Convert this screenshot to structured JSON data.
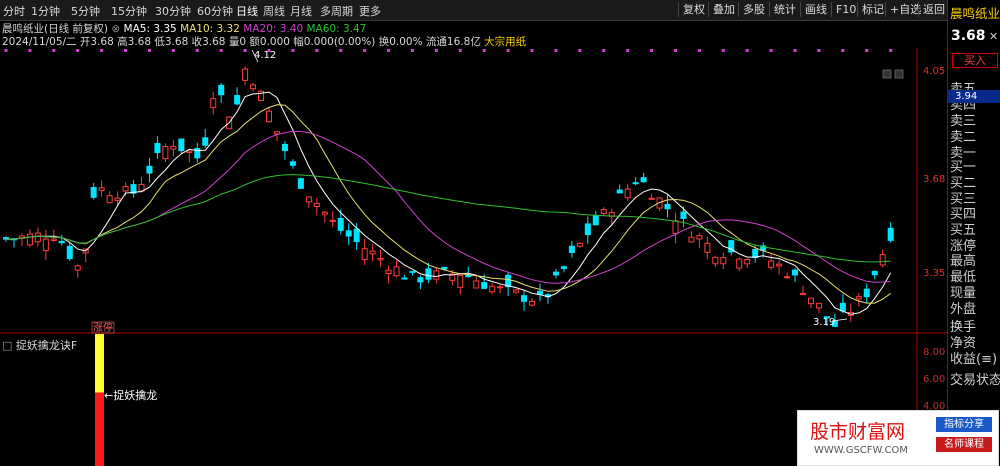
{
  "toolbar": {
    "periods": [
      "分时",
      "1分钟",
      "5分钟",
      "15分钟",
      "30分钟",
      "60分钟",
      "日线",
      "周线",
      "月线",
      "多周期",
      "更多"
    ],
    "active_period": "日线",
    "right_buttons": [
      "复权",
      "叠加",
      "多股",
      "统计",
      "画线",
      "F10",
      "标记",
      "+自选",
      "返回"
    ]
  },
  "info": {
    "stock": "晨鸣纸业(日线 前复权)",
    "ma5": "MA5: 3.35",
    "ma10": "MA10: 3.32",
    "ma20": "MA20: 3.40",
    "ma60": "MA60: 3.47",
    "date": "2024/11/05/二",
    "open": "开3.68",
    "high": "高3.68",
    "low": "低3.68",
    "close": "收3.68",
    "vol": "量0",
    "amount": "额0.000",
    "change": "幅0.000(0.00%)",
    "turnover": "换0.00%",
    "float": "流通16.8亿",
    "sector": "大宗用纸"
  },
  "right_panel": {
    "name": "晨鸣纸业",
    "price": "3.68",
    "buy_label": "买入",
    "book": [
      "卖五",
      "卖四",
      "卖三",
      "卖二",
      "卖一",
      "买一",
      "买二",
      "买三",
      "买四",
      "买五",
      "涨停",
      "最高",
      "最低",
      "现量",
      "外盘",
      "换手",
      "净资",
      "收益(≡)",
      "交易状态"
    ],
    "side_price": "3.94"
  },
  "axis": {
    "main_ticks": [
      "4.05",
      "3.68",
      "3.35"
    ],
    "ind_ticks": [
      "8.00",
      "6.00",
      "4.00"
    ]
  },
  "annotations": {
    "high": "4.12",
    "low": "3.19",
    "limit": "涨停"
  },
  "indicator": {
    "title": "捉妖擒龙诀F",
    "label": "←捉妖擒龙",
    "value_top": 10,
    "value_red": 5
  },
  "watermark": {
    "main": "股市财富网",
    "tag1": "指标分享",
    "tag2": "名师课程",
    "url": "WWW.GSCFW.COM"
  },
  "colors": {
    "up": "#ff3c3c",
    "down": "#00e5ff",
    "ma5": "#ffffff",
    "ma10": "#e8e070",
    "ma20": "#d040d0",
    "ma60": "#30c030",
    "axis": "#e03030"
  }
}
